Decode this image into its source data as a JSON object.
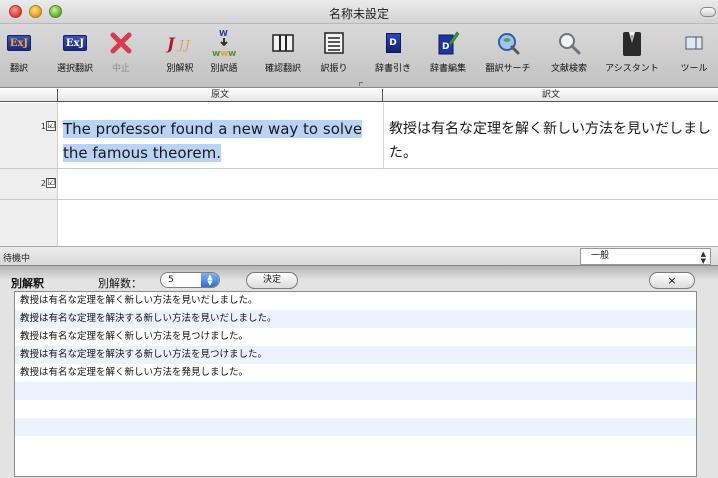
{
  "window": {
    "title": "名称未設定"
  },
  "toolbar": {
    "items": [
      {
        "label": "翻訳",
        "icon": "translate-icon"
      },
      {
        "label": "選択翻訳",
        "icon": "translate-selection-icon"
      },
      {
        "label": "中止",
        "icon": "stop-icon"
      },
      {
        "label": "別解釈",
        "icon": "alternate-interpretation-icon"
      },
      {
        "label": "別訳語",
        "icon": "alternate-word-icon"
      },
      {
        "label": "確認翻訳",
        "icon": "confirm-translation-icon"
      },
      {
        "label": "訳振り",
        "icon": "interlinear-icon"
      },
      {
        "label": "辞書引き",
        "icon": "dictionary-lookup-icon"
      },
      {
        "label": "辞書編集",
        "icon": "dictionary-edit-icon"
      },
      {
        "label": "翻訳サーチ",
        "icon": "translation-search-icon"
      },
      {
        "label": "文献検索",
        "icon": "literature-search-icon"
      },
      {
        "label": "アシスタント",
        "icon": "assistant-icon"
      },
      {
        "label": "ツール",
        "icon": "tool-icon"
      }
    ],
    "chip_texts": {
      "translate": "ExJ",
      "selection": "ExJ"
    }
  },
  "columns": {
    "source": "原文",
    "target": "訳文"
  },
  "rows": [
    {
      "number": "1",
      "checked": "☑",
      "source": "The professor found a new way to solve the famous theorem.",
      "target": "教授は有名な定理を解く新しい方法を見いだしました。"
    },
    {
      "number": "2",
      "checked": "☑",
      "source": "",
      "target": ""
    }
  ],
  "status": {
    "text": "待機中",
    "dictionary": "一般"
  },
  "alternates": {
    "title": "別解釈",
    "count_label": "別解数：",
    "count_value": "5",
    "ok_label": "決定",
    "close_label": "×",
    "items": [
      "教授は有名な定理を解く新しい方法を見いだしました。",
      "教授は有名な定理を解決する新しい方法を見いだしました。",
      "教授は有名な定理を解く新しい方法を見つけました。",
      "教授は有名な定理を解決する新しい方法を見つけました。",
      "教授は有名な定理を解く新しい方法を発見しました。"
    ]
  }
}
